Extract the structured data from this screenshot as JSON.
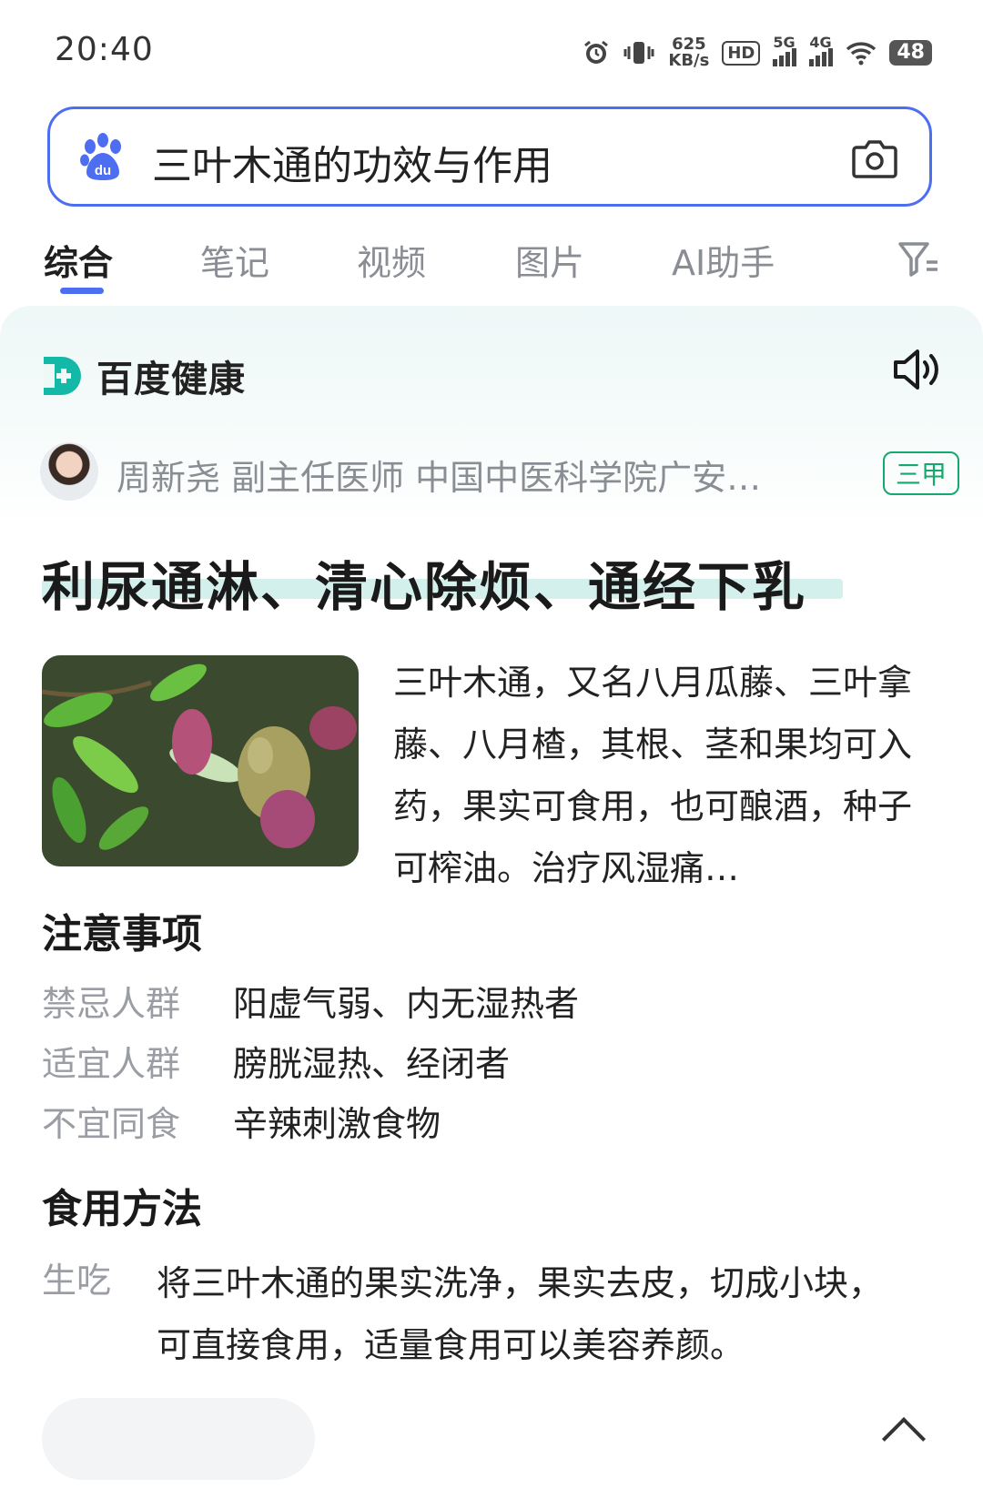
{
  "status_bar": {
    "time": "20:40",
    "speed_value": "625",
    "speed_unit": "KB/s",
    "hd": "HD",
    "sim1": "5G",
    "sim2": "4G",
    "battery": "48"
  },
  "search": {
    "query": "三叶木通的功效与作用"
  },
  "tabs": [
    "综合",
    "笔记",
    "视频",
    "图片",
    "AI助手"
  ],
  "card": {
    "brand": "百度健康",
    "doctor": "周新尧 副主任医师 中国中医科学院广安…",
    "grade": "三甲",
    "headline": "利尿通淋、清心除烦、通经下乳",
    "description": "三叶木通，又名八月瓜藤、三叶拿藤、八月楂，其根、茎和果均可入药，果实可食用，也可酿酒，种子可榨油。治疗风湿痛…",
    "notes_title": "注意事项",
    "notes": [
      {
        "key": "禁忌人群",
        "value": "阳虚气弱、内无湿热者"
      },
      {
        "key": "适宜人群",
        "value": "膀胱湿热、经闭者"
      },
      {
        "key": "不宜同食",
        "value": "辛辣刺激食物"
      }
    ],
    "method_title": "食用方法",
    "method": {
      "key": "生吃",
      "value": "将三叶木通的果实洗净，果实去皮，切成小块，可直接食用，适量食用可以美容养颜。"
    }
  },
  "colors": {
    "accent": "#4e6ef2",
    "brand_green": "#15a86f",
    "muted": "#8a8d93"
  }
}
